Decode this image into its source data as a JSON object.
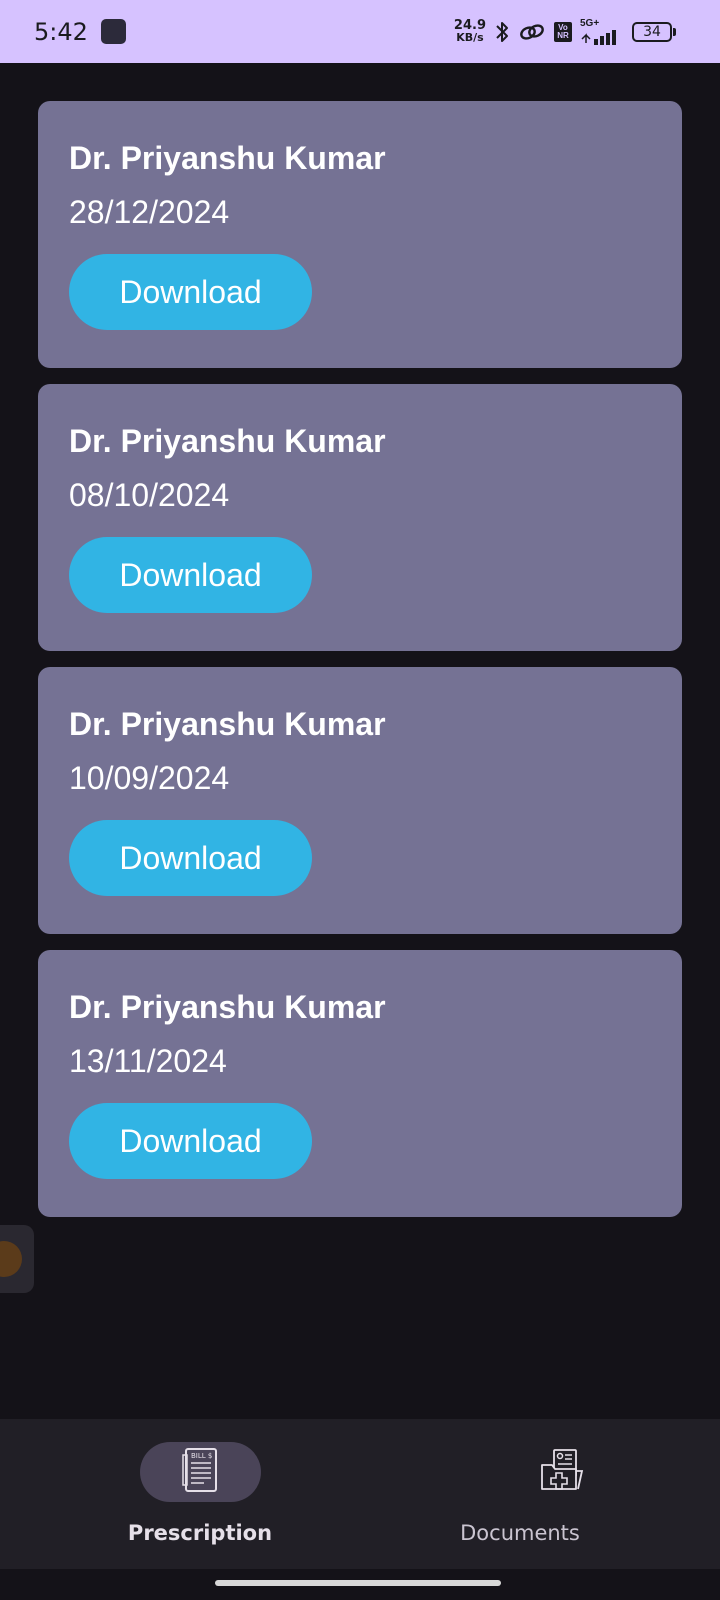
{
  "status_bar": {
    "time": "5:42",
    "net_speed_value": "24.9",
    "net_speed_unit": "KB/s",
    "volte_top": "Vo",
    "volte_bottom": "NR",
    "network_type": "5G+",
    "battery_level": "34",
    "icons": [
      "app-icon",
      "bluetooth-icon",
      "link-icon",
      "volte-icon",
      "signal-icon",
      "battery-icon"
    ]
  },
  "prescriptions": [
    {
      "doctor": "Dr. Priyanshu Kumar",
      "date": "28/12/2024",
      "action": "Download"
    },
    {
      "doctor": "Dr. Priyanshu Kumar",
      "date": "08/10/2024",
      "action": "Download"
    },
    {
      "doctor": "Dr. Priyanshu Kumar",
      "date": "10/09/2024",
      "action": "Download"
    },
    {
      "doctor": "Dr. Priyanshu Kumar",
      "date": "13/11/2024",
      "action": "Download"
    }
  ],
  "bottom_nav": {
    "items": [
      {
        "label": "Prescription",
        "icon": "bill-icon",
        "selected": true
      },
      {
        "label": "Documents",
        "icon": "medical-folder-icon",
        "selected": false
      }
    ]
  },
  "colors": {
    "status_bar_bg": "#d6c2ff",
    "background": "#141218",
    "card": "#757294",
    "button": "#31b4e4",
    "nav_bg": "#211f26",
    "nav_pill": "#4a4458"
  }
}
